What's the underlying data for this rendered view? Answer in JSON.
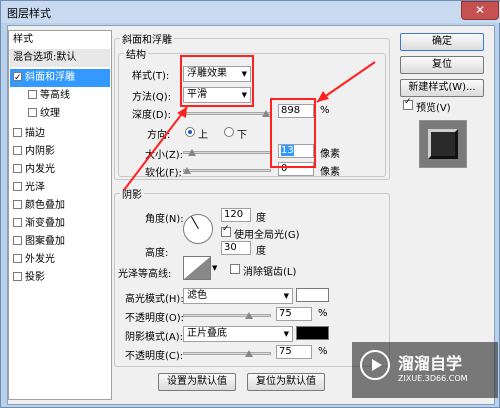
{
  "window": {
    "title": "图层样式",
    "close": "✕"
  },
  "left_list": {
    "header": "样式",
    "items": [
      {
        "label": "混合选项:默认",
        "checked": false
      },
      {
        "label": "斜面和浮雕",
        "checked": true
      },
      {
        "label": "等高线",
        "checked": false
      },
      {
        "label": "纹理",
        "checked": false
      },
      {
        "label": "描边",
        "checked": false
      },
      {
        "label": "内阴影",
        "checked": false
      },
      {
        "label": "内发光",
        "checked": false
      },
      {
        "label": "光泽",
        "checked": false
      },
      {
        "label": "颜色叠加",
        "checked": false
      },
      {
        "label": "渐变叠加",
        "checked": false
      },
      {
        "label": "图案叠加",
        "checked": false
      },
      {
        "label": "外发光",
        "checked": false
      },
      {
        "label": "投影",
        "checked": false
      }
    ]
  },
  "bevel": {
    "section_title": "斜面和浮雕",
    "structure_title": "结构",
    "style_label": "样式(T):",
    "style_value": "浮雕效果",
    "technique_label": "方法(Q):",
    "technique_value": "平滑",
    "depth_label": "深度(D):",
    "depth_value": "898",
    "depth_unit": "%",
    "direction_label": "方向:",
    "dir_up": "上",
    "dir_down": "下",
    "size_label": "大小(Z):",
    "size_value": "13",
    "size_unit": "像素",
    "soften_label": "软化(F):",
    "soften_value": "0",
    "soften_unit": "像素"
  },
  "shading": {
    "title": "阴影",
    "angle_label": "角度(N):",
    "angle_value": "120",
    "angle_unit": "度",
    "global_light_label": "使用全局光(G)",
    "altitude_label": "高度:",
    "altitude_value": "30",
    "altitude_unit": "度",
    "gloss_label": "光泽等高线:",
    "anti_alias_label": "消除锯齿(L)",
    "highlight_label": "高光模式(H):",
    "highlight_value": "滤色",
    "highlight_opacity_label": "不透明度(O):",
    "highlight_opacity_value": "75",
    "shadow_label": "阴影模式(A):",
    "shadow_value": "正片叠底",
    "shadow_opacity_label": "不透明度(C):",
    "shadow_opacity_value": "75",
    "pct": "%",
    "highlight_color": "#ffffff",
    "shadow_color": "#000000"
  },
  "buttons": {
    "make_default": "设置为默认值",
    "reset_default": "复位为默认值",
    "ok": "确定",
    "reset": "复位",
    "new_style": "新建样式(W)...",
    "preview": "预览(V)"
  },
  "watermark": {
    "brand": "溜溜自学",
    "url": "ZIXUE.3D66.COM"
  }
}
